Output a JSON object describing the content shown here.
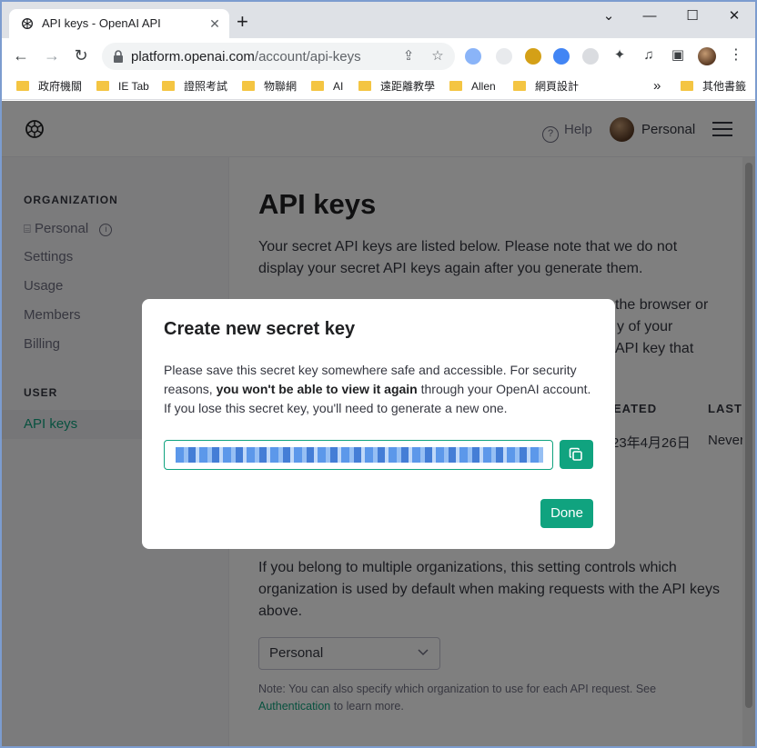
{
  "browser": {
    "tab_title": "API keys - OpenAI API",
    "tab_close": "✕",
    "new_tab": "+",
    "url_host": "platform.openai.com",
    "url_path": "/account/api-keys",
    "bookmarks": [
      "政府機關",
      "IE Tab",
      "證照考試",
      "物聯網",
      "AI",
      "遠距離教學",
      "Allen",
      "網頁設計"
    ],
    "bookmarks_overflow": "»",
    "other_bookmarks": "其他書籤"
  },
  "header": {
    "help": "Help",
    "account": "Personal"
  },
  "sidebar": {
    "org_heading": "ORGANIZATION",
    "org_name": "Personal",
    "items": [
      "Settings",
      "Usage",
      "Members",
      "Billing"
    ],
    "user_heading": "USER",
    "active_item": "API keys"
  },
  "main": {
    "title": "API keys",
    "intro": "Your secret API keys are listed below. Please note that we do not display your secret API keys again after you generate them.",
    "partial_line1": "the browser or",
    "partial_line2": "y of your",
    "partial_line3": "API key that",
    "col_created": "EATED",
    "col_last": "LAST",
    "created_value": "23年4月26日",
    "last_value": "Never",
    "org_paragraph": "If you belong to multiple organizations, this setting controls which organization is used by default when making requests with the API keys above.",
    "org_select": "Personal",
    "note_prefix": "Note: You can also specify which organization to use for each API request. See ",
    "note_link": "Authentication",
    "note_suffix": " to learn more."
  },
  "modal": {
    "title": "Create new secret key",
    "body_part1": "Please save this secret key somewhere safe and accessible. For security reasons, ",
    "body_bold": "you won't be able to view it again",
    "body_part2": " through your OpenAI account. If you lose this secret key, you'll need to generate a new one.",
    "done_label": "Done"
  },
  "colors": {
    "accent": "#10a37f",
    "overlay": "rgba(0,0,0,0.5)"
  }
}
